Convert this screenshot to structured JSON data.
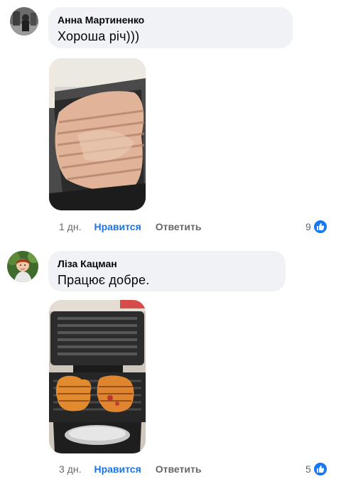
{
  "comments": [
    {
      "author": "Анна Мартиненко",
      "text": "Хороша річ)))",
      "time": "1 дн.",
      "like_label": "Нравится",
      "reply_label": "Ответить",
      "reaction_count": "9",
      "reaction_icon": "like-icon",
      "photo_subject": "sandwich-grill-with-chicken"
    },
    {
      "author": "Ліза Кацман",
      "text": "Працює добре.",
      "time": "3 дн.",
      "like_label": "Нравится",
      "reply_label": "Ответить",
      "reaction_count": "5",
      "reaction_icon": "like-icon",
      "photo_subject": "open-grill-with-toasts"
    }
  ],
  "colors": {
    "accent": "#1a74e4",
    "bubble": "#f0f2f5",
    "muted": "#65676b",
    "like_badge": "#1877f2"
  }
}
